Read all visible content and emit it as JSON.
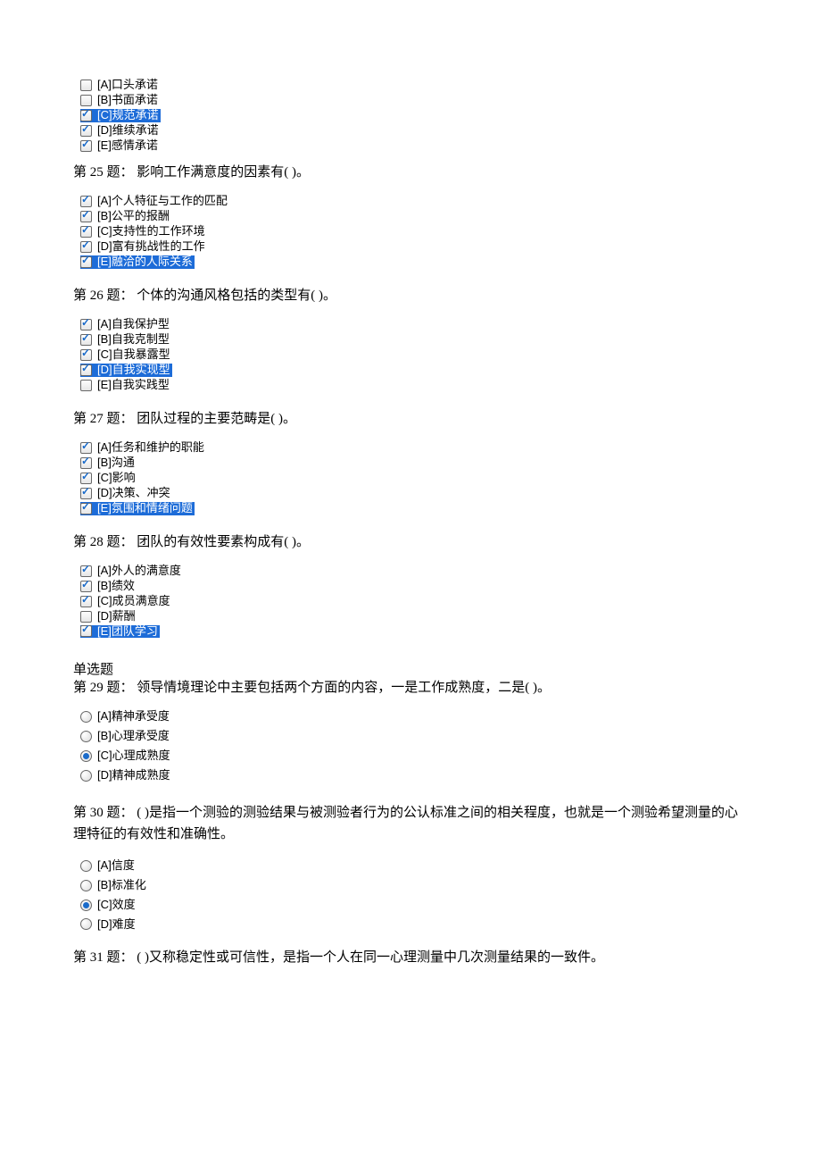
{
  "q24": {
    "options": [
      {
        "label": "[A]口头承诺",
        "checked": false,
        "highlight": false
      },
      {
        "label": "[B]书面承诺",
        "checked": false,
        "highlight": false
      },
      {
        "label": "[C]规范承诺",
        "checked": true,
        "highlight": true
      },
      {
        "label": "[D]维续承诺",
        "checked": true,
        "highlight": false
      },
      {
        "label": "[E]感情承诺",
        "checked": true,
        "highlight": false
      }
    ]
  },
  "q25": {
    "title": "第 25 题：   影响工作满意度的因素有(    )。",
    "options": [
      {
        "label": "[A]个人特征与工作的匹配",
        "checked": true,
        "highlight": false
      },
      {
        "label": "[B]公平的报酬",
        "checked": true,
        "highlight": false
      },
      {
        "label": "[C]支持性的工作环境",
        "checked": true,
        "highlight": false
      },
      {
        "label": "[D]富有挑战性的工作",
        "checked": true,
        "highlight": false
      },
      {
        "label": "[E]融洽的人际关系",
        "checked": true,
        "highlight": true
      }
    ]
  },
  "q26": {
    "title": "第 26 题：   个体的沟通风格包括的类型有(    )。",
    "options": [
      {
        "label": "[A]自我保护型",
        "checked": true,
        "highlight": false
      },
      {
        "label": "[B]自我克制型",
        "checked": true,
        "highlight": false
      },
      {
        "label": "[C]自我暴露型",
        "checked": true,
        "highlight": false
      },
      {
        "label": "[D]自我实现型",
        "checked": true,
        "highlight": true
      },
      {
        "label": "[E]自我实践型",
        "checked": false,
        "highlight": false
      }
    ]
  },
  "q27": {
    "title": "第 27 题：   团队过程的主要范畴是(    )。",
    "options": [
      {
        "label": "[A]任务和维护的职能",
        "checked": true,
        "highlight": false
      },
      {
        "label": "[B]沟通",
        "checked": true,
        "highlight": false
      },
      {
        "label": "[C]影响",
        "checked": true,
        "highlight": false
      },
      {
        "label": "[D]决策、冲突",
        "checked": true,
        "highlight": false
      },
      {
        "label": "[E]氛围和情绪问题",
        "checked": true,
        "highlight": true
      }
    ]
  },
  "q28": {
    "title": "第 28 题：   团队的有效性要素构成有(    )。",
    "options": [
      {
        "label": "[A]外人的满意度",
        "checked": true,
        "highlight": false
      },
      {
        "label": "[B]绩效",
        "checked": true,
        "highlight": false
      },
      {
        "label": "[C]成员满意度",
        "checked": true,
        "highlight": false
      },
      {
        "label": "[D]薪酬",
        "checked": false,
        "highlight": false
      },
      {
        "label": "[E]团队学习",
        "checked": true,
        "highlight": true
      }
    ]
  },
  "section_label": "单选题",
  "q29": {
    "title": "第 29 题：   领导情境理论中主要包括两个方面的内容，一是工作成熟度，二是(    )。",
    "options": [
      {
        "label": "[A]精神承受度",
        "checked": false
      },
      {
        "label": "[B]心理承受度",
        "checked": false
      },
      {
        "label": "[C]心理成熟度",
        "checked": true
      },
      {
        "label": "[D]精神成熟度",
        "checked": false
      }
    ]
  },
  "q30": {
    "title": "第 30 题：   (    )是指一个测验的测验结果与被测验者行为的公认标准之间的相关程度，也就是一个测验希望测量的心理特征的有效性和准确性。",
    "options": [
      {
        "label": "[A]信度",
        "checked": false
      },
      {
        "label": "[B]标准化",
        "checked": false
      },
      {
        "label": "[C]效度",
        "checked": true
      },
      {
        "label": "[D]难度",
        "checked": false
      }
    ]
  },
  "q31": {
    "title": "第 31 题：   (    )又称稳定性或可信性，是指一个人在同一心理测量中几次测量结果的一致件。"
  }
}
